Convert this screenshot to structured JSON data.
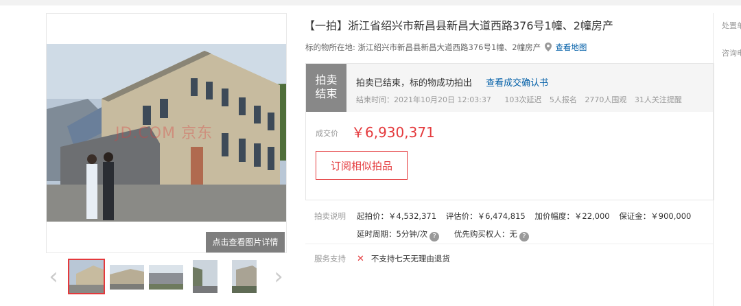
{
  "title": "【一拍】浙江省绍兴市新昌县新昌大道西路376号1幢、2幢房产",
  "location": {
    "label": "标的物所在地:",
    "address": "浙江绍兴市新昌县新昌大道西路376号1幢、2幢房产",
    "map_link": "查看地图",
    "icon": "location-pin-icon"
  },
  "gallery": {
    "watermark": "JD.COM 京东",
    "detail_button": "点击查看图片详情",
    "prev_icon": "chevron-left-icon",
    "next_icon": "chevron-right-icon",
    "thumbnail_count": 5,
    "active_thumbnail": 1
  },
  "status": {
    "badge_line1": "拍卖",
    "badge_line2": "结束",
    "message": "拍卖已结束，标的物成功拍出",
    "confirm_link": "查看成交确认书",
    "end_time_label": "结束时间：",
    "end_time": "2021年10月20日 12:03:37",
    "delays": "103次延迟",
    "signups": "5人报名",
    "views": "2770人围观",
    "reminders": "31人关注提醒"
  },
  "deal": {
    "label": "成交价",
    "price": "￥6,930,371"
  },
  "subscribe_button": "订阅相似拍品",
  "auction_info": {
    "label": "拍卖说明",
    "start_price": "起拍价：￥4,532,371",
    "appraisal": "评估价：￥6,474,815",
    "increment": "加价幅度：￥22,000",
    "deposit": "保证金：￥900,000",
    "delay_period": "延时周期：5分钟/次",
    "priority_buyer": "优先购买权人：无"
  },
  "service": {
    "label": "服务支持",
    "item": "不支持七天无理由退货"
  },
  "right_column": {
    "item1": "处置单",
    "item2": "咨询电"
  },
  "colors": {
    "accent_red": "#e4393c",
    "link_blue": "#005ea7",
    "badge_gray": "#888888"
  }
}
